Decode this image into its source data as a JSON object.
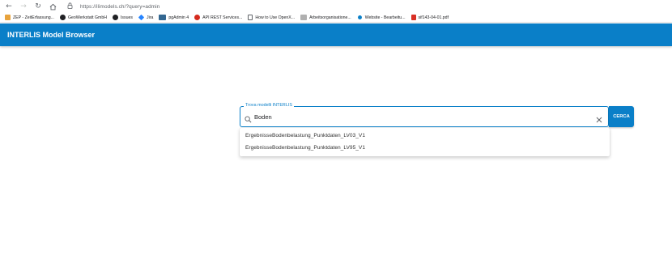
{
  "browser": {
    "url": "https://ilimodels.ch/?query=admin",
    "bookmarks": [
      {
        "label": "ZEP - ZeitErfassung...",
        "icon": "zep-icon",
        "color": "#e8a33d"
      },
      {
        "label": "GeoWerkstatt GmbH",
        "icon": "github-icon",
        "color": "#202124"
      },
      {
        "label": "Issues",
        "icon": "github-icon",
        "color": "#202124"
      },
      {
        "label": "Jira",
        "icon": "jira-icon",
        "color": "#2684ff"
      },
      {
        "label": "pgAdmin 4",
        "icon": "pgadmin-icon",
        "color": "#336791"
      },
      {
        "label": "API REST Services...",
        "icon": "swiss-flag-icon",
        "color": "#d52b1e"
      },
      {
        "label": "How to Use OpenX...",
        "icon": "page-icon",
        "color": "#5f6368"
      },
      {
        "label": "Arbeitsorganisatione...",
        "icon": "image-icon",
        "color": "#8a8a8a"
      },
      {
        "label": "Website - Bearbeitu...",
        "icon": "website-icon",
        "color": "#0a7fc8"
      },
      {
        "label": "sif143-04-01.pdf",
        "icon": "pdf-icon",
        "color": "#d93025"
      }
    ]
  },
  "app": {
    "title": "INTERLIS Model Browser"
  },
  "search": {
    "label": "Trova modelli INTERLIS",
    "value": "Boden",
    "button_label": "CERCA"
  },
  "suggestions": [
    "ErgebnisseBodenbelastung_Punktdaten_LV03_V1",
    "ErgebnisseBodenbelastung_Punktdaten_LV95_V1"
  ]
}
